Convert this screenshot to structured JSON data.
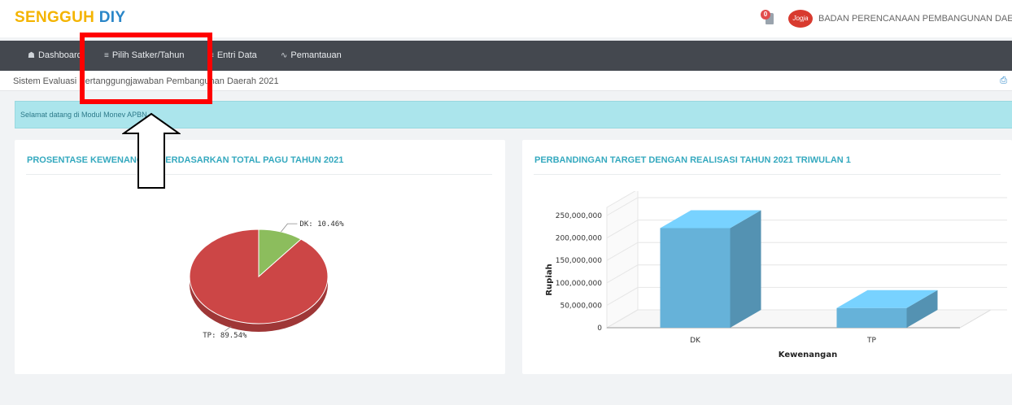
{
  "app": {
    "brand_part1": "SENGGUH",
    "brand_part2": "DIY"
  },
  "header": {
    "notification_count": "0",
    "avatar_text": "Jogja",
    "org_name": "BADAN PERENCANAAN PEMBANGUNAN DAERAH"
  },
  "nav": {
    "items": [
      {
        "label": "Dashboard",
        "icon": "home-icon"
      },
      {
        "label": "Pilih Satker/Tahun",
        "icon": "list-icon"
      },
      {
        "label": "Entri Data",
        "icon": "list-icon"
      },
      {
        "label": "Pemantauan",
        "icon": "chart-line-icon"
      }
    ]
  },
  "subheader": {
    "title": "Sistem Evaluasi Pertanggungjawaban Pembangunan Daerah 2021"
  },
  "alert": {
    "text": "Selamat datang di Modul Monev APBN"
  },
  "colors": {
    "accent": "#35a9bf",
    "navbar": "#44484f",
    "pie_tp": "#cc4646",
    "pie_dk": "#8cbd5d",
    "bar": "#66b2d9",
    "annotation": "#ff0000"
  },
  "pie_panel": {
    "title": "PROSENTASE KEWENANGAN BERDASARKAN TOTAL PAGU TAHUN 2021"
  },
  "bar_panel": {
    "title": "PERBANDINGAN TARGET DENGAN REALISASI TAHUN 2021 TRIWULAN 1"
  },
  "chart_data": [
    {
      "type": "pie",
      "title": "PROSENTASE KEWENANGAN BERDASARKAN TOTAL PAGU TAHUN 2021",
      "slices": [
        {
          "label": "TP",
          "value": 89.54,
          "display": "TP: 89.54%"
        },
        {
          "label": "DK",
          "value": 10.46,
          "display": "DK: 10.46%"
        }
      ]
    },
    {
      "type": "bar",
      "title": "PERBANDINGAN TARGET DENGAN REALISASI TAHUN 2021 TRIWULAN 1",
      "categories": [
        "DK",
        "TP"
      ],
      "values": [
        222000000,
        44000000
      ],
      "xlabel": "Kewenangan",
      "ylabel": "Rupiah",
      "ylim": [
        0,
        250000000
      ],
      "yticks": [
        "0",
        "50,000,000",
        "100,000,000",
        "150,000,000",
        "200,000,000",
        "250,000,000"
      ],
      "grid": true
    }
  ]
}
